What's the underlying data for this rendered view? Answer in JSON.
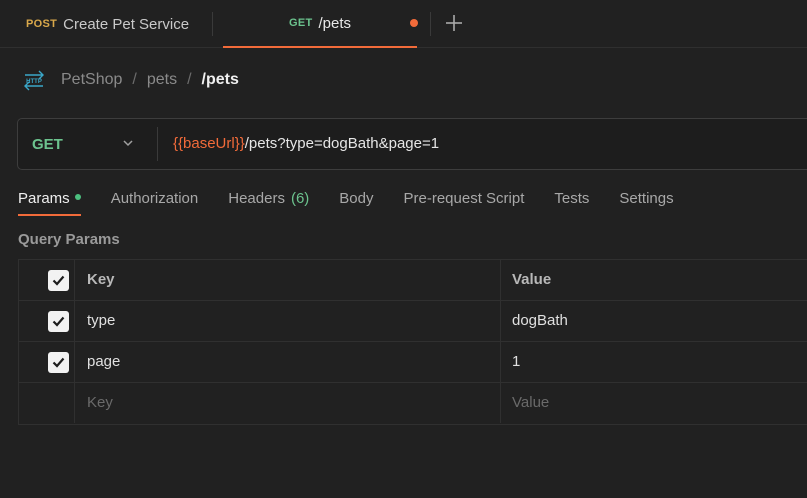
{
  "tabs": [
    {
      "method": "POST",
      "title": "Create Pet Service"
    },
    {
      "method": "GET",
      "title": "/pets"
    }
  ],
  "breadcrumb": {
    "items": [
      "PetShop",
      "pets"
    ],
    "current": "/pets",
    "separator": "/"
  },
  "request": {
    "method": "GET",
    "url_variable": "{{baseUrl}}",
    "url_rest": "/pets?type=dogBath&page=1"
  },
  "request_tabs": [
    {
      "label": "Params"
    },
    {
      "label": "Authorization"
    },
    {
      "label": "Headers",
      "count": "(6)"
    },
    {
      "label": "Body"
    },
    {
      "label": "Pre-request Script"
    },
    {
      "label": "Tests"
    },
    {
      "label": "Settings"
    }
  ],
  "query_params": {
    "title": "Query Params",
    "header": {
      "key": "Key",
      "value": "Value"
    },
    "rows": [
      {
        "key": "type",
        "value": "dogBath",
        "checked": true
      },
      {
        "key": "page",
        "value": "1",
        "checked": true
      }
    ],
    "placeholder": {
      "key": "Key",
      "value": "Value"
    }
  },
  "colors": {
    "accent": "#f26b3a",
    "get": "#6cc38e",
    "post": "#d9a84b",
    "background": "#212121"
  },
  "icons": [
    "http-icon",
    "chevron-down-icon",
    "plus-icon",
    "checkbox-checked-icon"
  ]
}
